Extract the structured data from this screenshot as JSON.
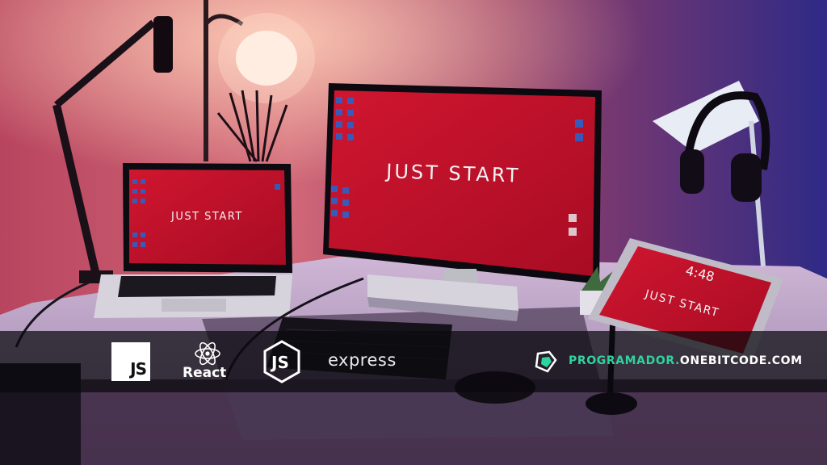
{
  "monitor": {
    "headline": "JUST START"
  },
  "laptop": {
    "headline": "JUST START"
  },
  "tablet": {
    "time": "4:48",
    "headline": "JUST START"
  },
  "banner": {
    "js_logo": "JS",
    "react_label": "React",
    "express_label": "express",
    "site_part1": "PROGRAMADOR.",
    "site_part2": "ONEBITCODE.COM"
  },
  "colors": {
    "screen_red": "#c8122c",
    "wall_left": "#c24a63",
    "wall_right": "#3a2a8a",
    "accent_green": "#2fd3a0"
  }
}
